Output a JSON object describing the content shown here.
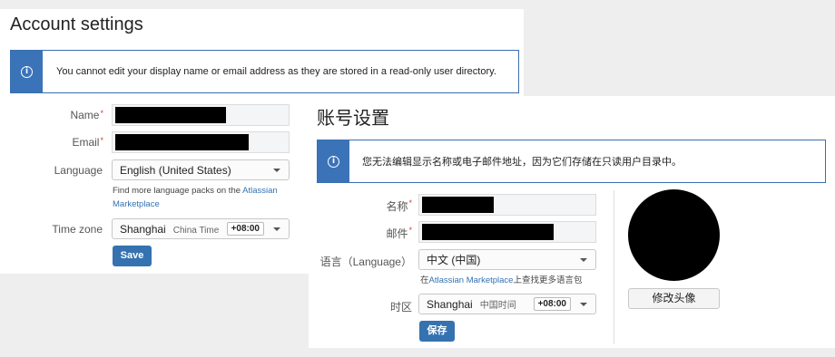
{
  "en": {
    "title": "Account settings",
    "notice": "You cannot edit your display name or email address as they are stored in a read-only user directory.",
    "name_label": "Name",
    "email_label": "Email",
    "language_label": "Language",
    "language_value": "English (United States)",
    "help_prefix": "Find more language packs on the",
    "help_link1": "Atlassian",
    "help_link2": "Marketplace",
    "timezone_label": "Time zone",
    "timezone_city": "Shanghai",
    "timezone_name": "China Time",
    "timezone_offset": "+08:00",
    "save_label": "Save"
  },
  "zh": {
    "title": "账号设置",
    "notice": "您无法编辑显示名称或电子邮件地址，因为它们存储在只读用户目录中。",
    "name_label": "名称",
    "email_label": "邮件",
    "language_label": "语言（Language）",
    "language_value": "中文 (中国)",
    "help_prefix": "在",
    "help_link": "Atlassian Marketplace",
    "help_suffix": "上查找更多语言包",
    "timezone_label": "时区",
    "timezone_city": "Shanghai",
    "timezone_name": "中国时间",
    "timezone_offset": "+08:00",
    "save_label": "保存",
    "change_avatar_label": "修改头像"
  },
  "required_marker": "*",
  "icons": {
    "info": "info-icon",
    "dropdown": "chevron-down-icon"
  },
  "colors": {
    "primary": "#3572b0",
    "required": "#d04437",
    "info_border": "#3a6fb0"
  }
}
